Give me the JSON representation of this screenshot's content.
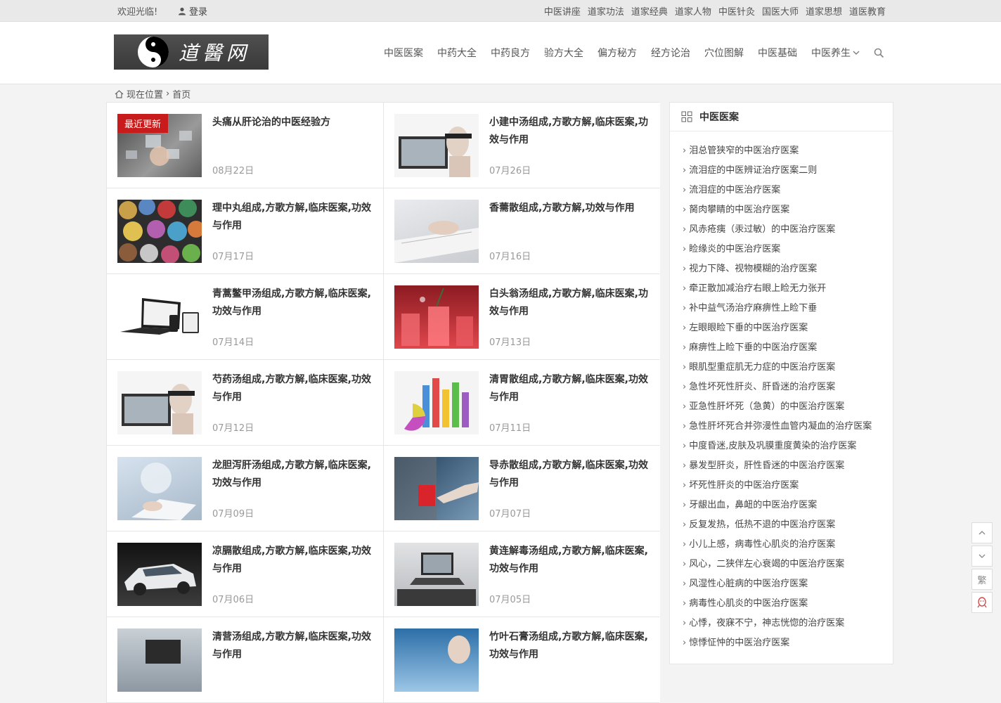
{
  "topbar": {
    "welcome": "欢迎光临!",
    "login": "登录",
    "links": [
      "中医讲座",
      "道家功法",
      "道家经典",
      "道家人物",
      "中医针灸",
      "国医大师",
      "道家思想",
      "道医教育"
    ]
  },
  "logo": {
    "text": "道醫网"
  },
  "nav": {
    "items": [
      "中医医案",
      "中药大全",
      "中药良方",
      "验方大全",
      "偏方秘方",
      "经方论治",
      "穴位图解",
      "中医基础"
    ],
    "more_label": "中医养生"
  },
  "breadcrumb": {
    "label": "现在位置",
    "current": "首页"
  },
  "articles": [
    {
      "title": "头痛从肝论治的中医经验方",
      "date": "08月22日",
      "badge": "最近更新"
    },
    {
      "title": "小建中汤组成,方歌方解,临床医案,功效与作用",
      "date": "07月26日"
    },
    {
      "title": "理中丸组成,方歌方解,临床医案,功效与作用",
      "date": "07月17日"
    },
    {
      "title": "香薷散组成,方歌方解,功效与作用",
      "date": "07月16日"
    },
    {
      "title": "青蒿鳖甲汤组成,方歌方解,临床医案,功效与作用",
      "date": "07月14日"
    },
    {
      "title": "白头翁汤组成,方歌方解,临床医案,功效与作用",
      "date": "07月13日"
    },
    {
      "title": "芍药汤组成,方歌方解,临床医案,功效与作用",
      "date": "07月12日"
    },
    {
      "title": "清胃散组成,方歌方解,临床医案,功效与作用",
      "date": "07月11日"
    },
    {
      "title": "龙胆泻肝汤组成,方歌方解,临床医案,功效与作用",
      "date": "07月09日"
    },
    {
      "title": "导赤散组成,方歌方解,临床医案,功效与作用",
      "date": "07月07日"
    },
    {
      "title": "凉膈散组成,方歌方解,临床医案,功效与作用",
      "date": "07月06日"
    },
    {
      "title": "黄连解毒汤组成,方歌方解,临床医案,功效与作用",
      "date": "07月05日"
    },
    {
      "title": "清营汤组成,方歌方解,临床医案,功效与作用",
      "date": ""
    },
    {
      "title": "竹叶石膏汤组成,方歌方解,临床医案,功效与作用",
      "date": ""
    }
  ],
  "sidebar": {
    "title": "中医医案",
    "items": [
      "泪总管狭窄的中医治疗医案",
      "流泪症的中医辨证治疗医案二则",
      "流泪症的中医治疗医案",
      "胬肉攀睛的中医治疗医案",
      "风赤疮痍（汞过敏）的中医治疗医案",
      "睑缘炎的中医治疗医案",
      "视力下降、视物模糊的治疗医案",
      "牵正散加减治疗右眼上睑无力张开",
      "补中益气汤治疗麻痹性上睑下垂",
      "左眼眼睑下垂的中医治疗医案",
      "麻痹性上睑下垂的中医治疗医案",
      "眼肌型重症肌无力症的中医治疗医案",
      "急性坏死性肝炎、肝昏迷的治疗医案",
      "亚急性肝坏死（急黄）的中医治疗医案",
      "急性肝坏死合并弥漫性血管内凝血的治疗医案",
      "中度昏迷,皮肤及巩膜重度黄染的治疗医案",
      "暴发型肝炎，肝性昏迷的中医治疗医案",
      "坏死性肝炎的中医治疗医案",
      "牙龈出血，鼻衄的中医治疗医案",
      "反复发热，低热不退的中医治疗医案",
      "小儿上感，病毒性心肌炎的治疗医案",
      "风心，二狭伴左心衰竭的中医治疗医案",
      "风湿性心脏病的中医治疗医案",
      "病毒性心肌炎的中医治疗医案",
      "心悸，夜寐不宁，神志恍惚的治疗医案",
      "惊悸怔忡的中医治疗医案"
    ]
  },
  "float": {
    "fan_label": "繁"
  }
}
